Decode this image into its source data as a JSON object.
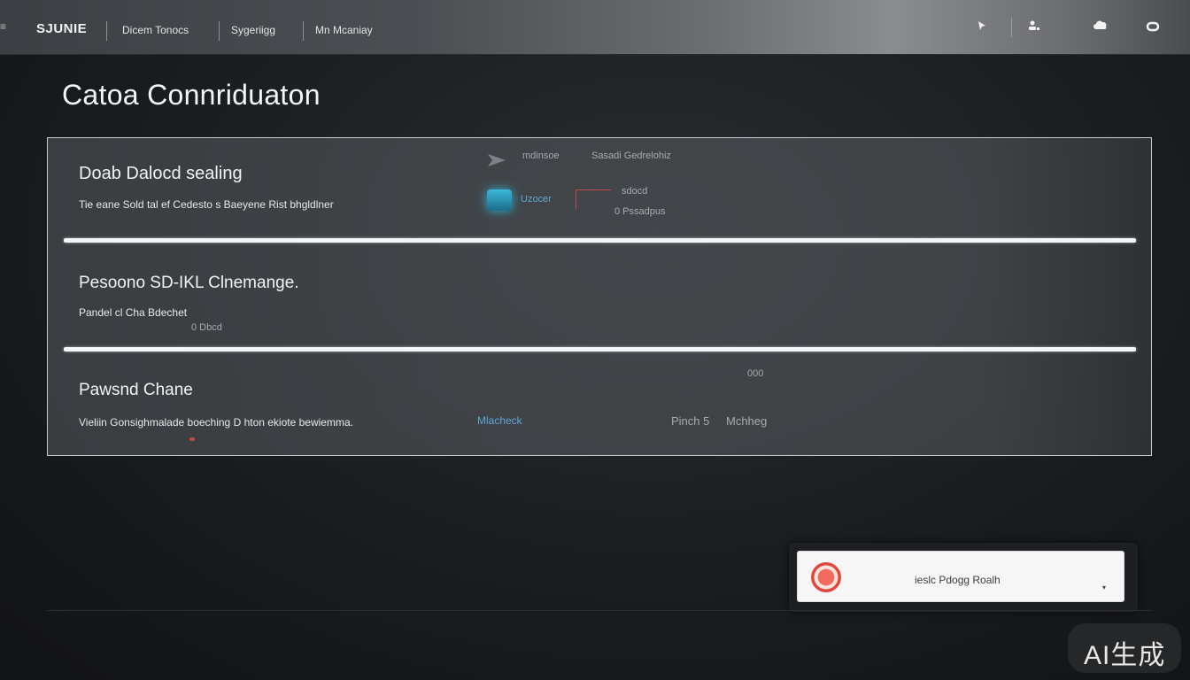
{
  "topbar": {
    "brand": "SJUNIE",
    "nav": [
      "Dicem Tonocs",
      "Sygeriigg",
      "Mn Mcaniay"
    ],
    "icons": [
      "menu-icon",
      "pin-icon",
      "user-icon",
      "cloud-icon",
      "link-icon"
    ]
  },
  "page": {
    "title": "Catoa Connriduaton"
  },
  "sections": [
    {
      "title": "Doab Dalocd sealing",
      "desc": "Tie eane Sold tal ef Cedesto s Baeyene Rist bhgldlner",
      "extras": {
        "label_a": "mdinsoe",
        "label_b": "Sasadi Gedrelohiz",
        "label_c": "Uzocer",
        "label_d": "sdocd",
        "label_e": "0 Pssadpus"
      }
    },
    {
      "title": "Pesoono SD-IKL Clnemange.",
      "desc": "Pandel cl Cha Bdechet",
      "extras": {
        "label_a": "0 Dbcd"
      }
    },
    {
      "title": "Pawsnd Chane",
      "desc": "Vieliin Gonsighmalade boeching D hton ekiote bewiemma.",
      "extras": {
        "label_a": "Mlacheck",
        "label_b": "Pinch 5",
        "label_c": "Mchheg",
        "label_d": "000"
      }
    }
  ],
  "toast": {
    "text": "ieslc Pdogg Roalh",
    "icon": "alert-icon"
  },
  "watermark": "AI生成",
  "colors": {
    "accent": "#5ea8d8",
    "alert": "#e2473c",
    "topbar": "#6c6e70"
  }
}
